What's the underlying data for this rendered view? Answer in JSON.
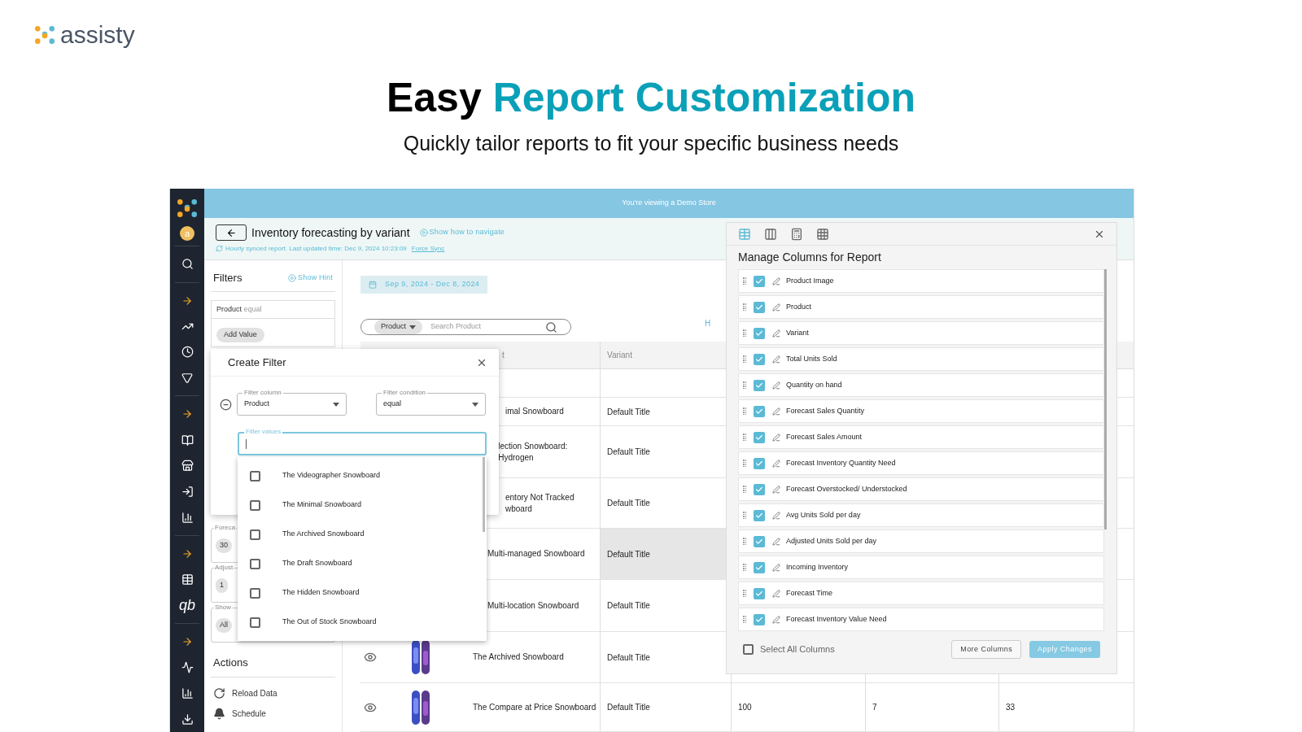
{
  "brand": {
    "name": "assisty"
  },
  "hero": {
    "title_plain": "Easy",
    "title_accent": "Report Customization",
    "subtitle": "Quickly tailor reports to fit your specific business needs"
  },
  "app": {
    "banner": "You're viewing a Demo Store",
    "sidebar": {
      "avatar": "a",
      "qb_label": "qb"
    },
    "header": {
      "title": "Inventory forecasting by variant",
      "help_link": "Show how to navigate",
      "sync_text": "Hourly synced report. Last updated time: Dec 9, 2024 10:23:09",
      "sync_link": "Force Sync"
    },
    "filters": {
      "title": "Filters",
      "hint_link": "Show Hint",
      "rule": {
        "column": "Product",
        "condition": "equal",
        "add_button": "Add Value"
      },
      "fields": [
        {
          "label": "Foreca",
          "value": "30"
        },
        {
          "label": "Adjust",
          "value": "1"
        },
        {
          "label": "Show",
          "value": "All"
        }
      ]
    },
    "actions": {
      "title": "Actions",
      "items": [
        {
          "label": "Reload Data",
          "kind": "reload"
        },
        {
          "label": "Schedule",
          "kind": "schedule"
        }
      ]
    },
    "date_range": "Sep 9, 2024 - Dec 8, 2024",
    "search": {
      "scope": "Product",
      "placeholder": "Search Product"
    },
    "stray_text": "H",
    "table": {
      "columns": [
        "t",
        "Variant"
      ],
      "rows": [
        {
          "highlighted": false
        },
        {
          "product_lines": [
            "imal Snowboard"
          ],
          "variant": "Default Title",
          "highlighted": false
        },
        {
          "product_lines": [
            "lection Snowboard: Hydrogen"
          ],
          "variant": "Default Title",
          "highlighted": false
        },
        {
          "product_lines": [
            "entory Not Tracked",
            "wboard"
          ],
          "variant": "Default Title",
          "highlighted": false
        },
        {
          "product_lines": [
            "Multi-managed Snowboard"
          ],
          "variant": "Default Title",
          "highlighted": true
        },
        {
          "product_lines": [
            "Multi-location Snowboard"
          ],
          "variant": "Default Title",
          "highlighted": false
        },
        {
          "product_lines": [
            "The Archived Snowboard"
          ],
          "variant": "Default Title",
          "highlighted": false,
          "image": {
            "kind": "picture"
          }
        },
        {
          "product_lines": [
            "The Compare at Price Snowboard"
          ],
          "variant": "Default Title",
          "highlighted": false,
          "image": {
            "kind": "picture"
          },
          "values": [
            "100",
            "7",
            "33"
          ]
        }
      ]
    },
    "create_filter": {
      "title": "Create Filter",
      "column_field": {
        "label": "Filter column",
        "value": "Product"
      },
      "condition_field": {
        "label": "Filter condition",
        "value": "equal"
      },
      "values_field": {
        "label": "Filter values",
        "focused": true
      },
      "options": [
        {
          "label": "The Videographer Snowboard",
          "checked": false
        },
        {
          "label": "The Minimal Snowboard",
          "checked": false
        },
        {
          "label": "The Archived Snowboard",
          "checked": false
        },
        {
          "label": "The Draft Snowboard",
          "checked": false
        },
        {
          "label": "The Hidden Snowboard",
          "checked": false
        },
        {
          "label": "The Out of Stock Snowboard",
          "checked": false
        }
      ]
    },
    "manage_columns": {
      "tools": [
        {
          "selected": true
        },
        {
          "selected": false
        },
        {
          "selected": false
        },
        {
          "selected": false
        }
      ],
      "title": "Manage Columns for Report",
      "columns": [
        {
          "label": "Product Image",
          "checked": true
        },
        {
          "label": "Product",
          "checked": true
        },
        {
          "label": "Variant",
          "checked": true
        },
        {
          "label": "Total Units Sold",
          "checked": true
        },
        {
          "label": "Quantity on hand",
          "checked": true
        },
        {
          "label": "Forecast Sales Quantity",
          "checked": true
        },
        {
          "label": "Forecast Sales Amount",
          "checked": true
        },
        {
          "label": "Forecast Inventory Quantity Need",
          "checked": true
        },
        {
          "label": "Forecast Overstocked/ Understocked",
          "checked": true
        },
        {
          "label": "Avg Units Sold per day",
          "checked": true
        },
        {
          "label": "Adjusted Units Sold per day",
          "checked": true
        },
        {
          "label": "Incoming Inventory",
          "checked": true
        },
        {
          "label": "Forecast Time",
          "checked": true
        },
        {
          "label": "Forecast Inventory Value Need",
          "checked": true
        }
      ],
      "select_all": {
        "label": "Select All Columns",
        "checked": false
      },
      "buttons": [
        "More Columns",
        "Apply Changes"
      ]
    }
  }
}
